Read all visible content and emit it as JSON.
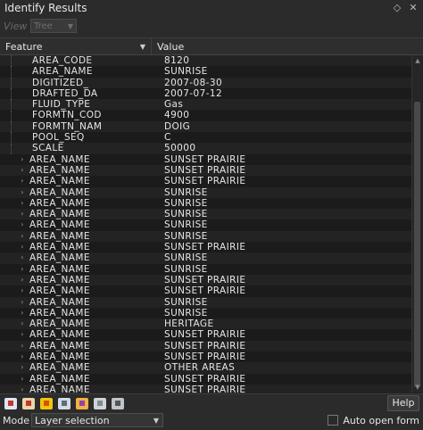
{
  "window": {
    "title": "Identify Results"
  },
  "view": {
    "label": "View",
    "selected": "Tree"
  },
  "columns": {
    "feature": "Feature",
    "value": "Value"
  },
  "rows": [
    {
      "type": "child",
      "feature": "AREA_CODE",
      "value": "8120"
    },
    {
      "type": "child",
      "feature": "AREA_NAME",
      "value": "SUNRISE"
    },
    {
      "type": "child",
      "feature": "DIGITIZED_",
      "value": "2007-08-30"
    },
    {
      "type": "child",
      "feature": "DRAFTED_DA",
      "value": "2007-07-12"
    },
    {
      "type": "child",
      "feature": "FLUID_TYPE",
      "value": "Gas"
    },
    {
      "type": "child",
      "feature": "FORMTN_COD",
      "value": "4900"
    },
    {
      "type": "child",
      "feature": "FORMTN_NAM",
      "value": "DOIG"
    },
    {
      "type": "child",
      "feature": "POOL_SEQ",
      "value": "C"
    },
    {
      "type": "child",
      "feature": "SCALE",
      "value": "50000"
    },
    {
      "type": "parent",
      "feature": "AREA_NAME",
      "value": "SUNSET PRAIRIE"
    },
    {
      "type": "parent",
      "feature": "AREA_NAME",
      "value": "SUNSET PRAIRIE"
    },
    {
      "type": "parent",
      "feature": "AREA_NAME",
      "value": "SUNSET PRAIRIE"
    },
    {
      "type": "parent",
      "feature": "AREA_NAME",
      "value": "SUNRISE"
    },
    {
      "type": "parent",
      "feature": "AREA_NAME",
      "value": "SUNRISE"
    },
    {
      "type": "parent",
      "feature": "AREA_NAME",
      "value": "SUNRISE"
    },
    {
      "type": "parent",
      "feature": "AREA_NAME",
      "value": "SUNRISE"
    },
    {
      "type": "parent",
      "feature": "AREA_NAME",
      "value": "SUNRISE"
    },
    {
      "type": "parent",
      "feature": "AREA_NAME",
      "value": "SUNSET PRAIRIE"
    },
    {
      "type": "parent",
      "feature": "AREA_NAME",
      "value": "SUNRISE"
    },
    {
      "type": "parent",
      "feature": "AREA_NAME",
      "value": "SUNRISE"
    },
    {
      "type": "parent",
      "feature": "AREA_NAME",
      "value": "SUNSET PRAIRIE"
    },
    {
      "type": "parent",
      "feature": "AREA_NAME",
      "value": "SUNSET PRAIRIE"
    },
    {
      "type": "parent",
      "feature": "AREA_NAME",
      "value": "SUNRISE"
    },
    {
      "type": "parent",
      "feature": "AREA_NAME",
      "value": "SUNRISE"
    },
    {
      "type": "parent",
      "feature": "AREA_NAME",
      "value": "HERITAGE"
    },
    {
      "type": "parent",
      "feature": "AREA_NAME",
      "value": "SUNSET PRAIRIE"
    },
    {
      "type": "parent",
      "feature": "AREA_NAME",
      "value": "SUNSET PRAIRIE"
    },
    {
      "type": "parent",
      "feature": "AREA_NAME",
      "value": "SUNSET PRAIRIE"
    },
    {
      "type": "parent",
      "feature": "AREA_NAME",
      "value": "OTHER AREAS"
    },
    {
      "type": "parent",
      "feature": "AREA_NAME",
      "value": "SUNSET PRAIRIE"
    },
    {
      "type": "parent",
      "feature": "AREA_NAME",
      "value": "SUNSET PRAIRIE"
    }
  ],
  "toolbar": {
    "tools": [
      {
        "name": "clear-results-icon",
        "color": "#c0392b",
        "bg": "#dfe6f0"
      },
      {
        "name": "expand-tree-icon",
        "color": "#c0392b",
        "bg": "#e9d6a8"
      },
      {
        "name": "expand-new-icon",
        "color": "#d35400",
        "bg": "#f1c40f"
      },
      {
        "name": "collapse-tree-icon",
        "color": "#5d6d7e",
        "bg": "#d5dbe2"
      },
      {
        "name": "select-features-icon",
        "color": "#8e44ad",
        "bg": "#f5b041"
      },
      {
        "name": "copy-icon",
        "color": "#7f8c8d",
        "bg": "#cfd4d8"
      },
      {
        "name": "print-icon",
        "color": "#555",
        "bg": "#bfc5ca"
      }
    ],
    "help_label": "Help"
  },
  "mode": {
    "label": "Mode",
    "selected": "Layer selection"
  },
  "auto_open": {
    "label": "Auto open form",
    "checked": false
  }
}
